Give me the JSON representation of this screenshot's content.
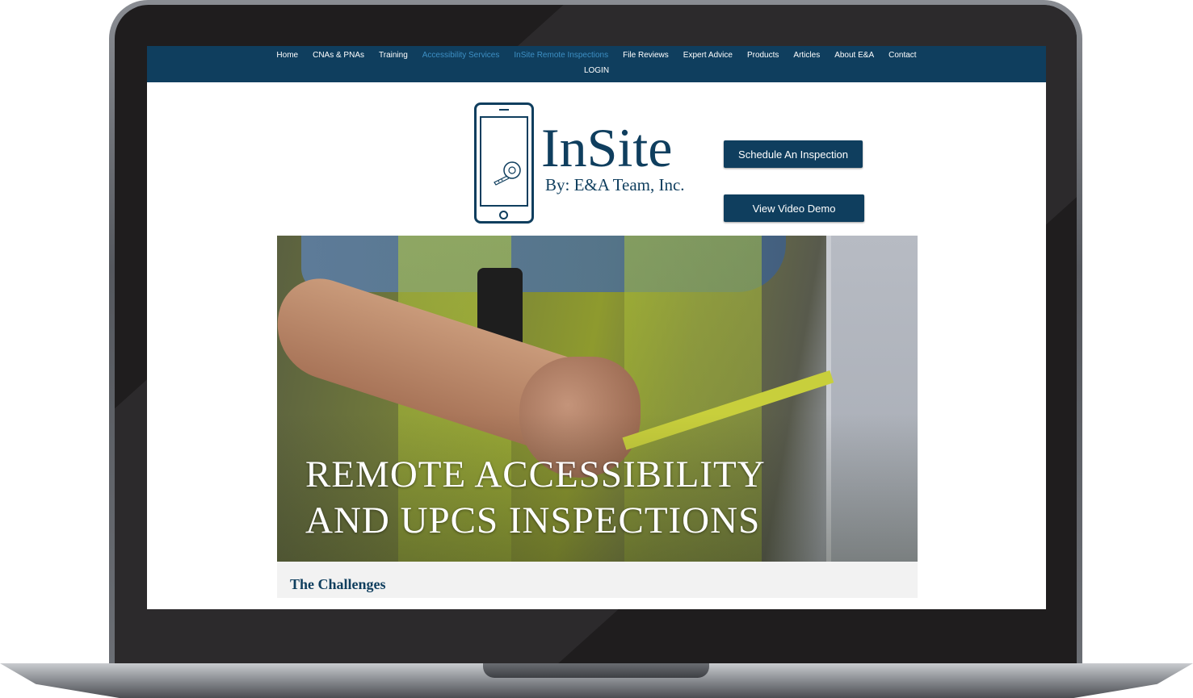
{
  "nav": {
    "items": [
      {
        "label": "Home"
      },
      {
        "label": "CNAs & PNAs"
      },
      {
        "label": "Training"
      },
      {
        "label": "Accessibility Services"
      },
      {
        "label": "InSite Remote Inspections"
      },
      {
        "label": "File Reviews"
      },
      {
        "label": "Expert Advice"
      },
      {
        "label": "Products"
      },
      {
        "label": "Articles"
      },
      {
        "label": "About E&A"
      },
      {
        "label": "Contact"
      }
    ],
    "login": "LOGIN"
  },
  "logo": {
    "title": "InSite",
    "subtitle": "By: E&A Team, Inc.",
    "icon": "phone-tape-measure-icon"
  },
  "buttons": {
    "schedule": "Schedule An Inspection",
    "demo": "View Video Demo"
  },
  "hero": {
    "line1": "REMOTE ACCESSIBILITY",
    "line2": "AND UPCS INSPECTIONS"
  },
  "section": {
    "title": "The Challenges"
  },
  "colors": {
    "brand": "#0f3e5e",
    "nav_dim": "#3d8fc4",
    "section_bg": "#f2f2f2"
  }
}
